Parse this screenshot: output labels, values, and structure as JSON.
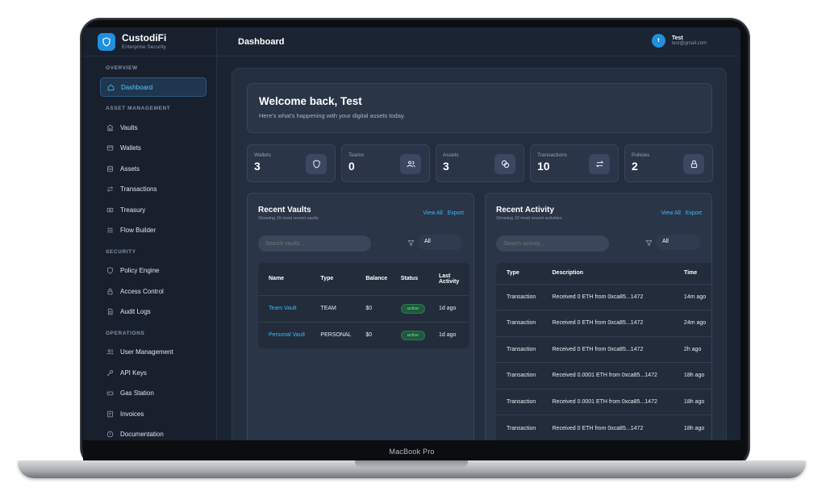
{
  "brand": {
    "name": "CustodiFi",
    "subtitle": "Enterprise Security"
  },
  "header": {
    "title": "Dashboard",
    "user_initial": "t",
    "user_name": "Test",
    "user_email": "test@gmail.com"
  },
  "sidebar": {
    "sections": [
      {
        "title": "OVERVIEW",
        "items": [
          {
            "label": "Dashboard",
            "icon": "home-icon",
            "active": true
          }
        ]
      },
      {
        "title": "ASSET MANAGEMENT",
        "items": [
          {
            "label": "Vaults",
            "icon": "vault-icon"
          },
          {
            "label": "Wallets",
            "icon": "wallet-icon"
          },
          {
            "label": "Assets",
            "icon": "database-icon"
          },
          {
            "label": "Transactions",
            "icon": "arrows-icon"
          },
          {
            "label": "Treasury",
            "icon": "treasury-icon"
          },
          {
            "label": "Flow Builder",
            "icon": "grid-icon"
          }
        ]
      },
      {
        "title": "SECURITY",
        "items": [
          {
            "label": "Policy Engine",
            "icon": "shield-icon"
          },
          {
            "label": "Access Control",
            "icon": "lock-icon"
          },
          {
            "label": "Audit Logs",
            "icon": "file-icon"
          }
        ]
      },
      {
        "title": "OPERATIONS",
        "items": [
          {
            "label": "User Management",
            "icon": "users-icon"
          },
          {
            "label": "API Keys",
            "icon": "key-icon"
          },
          {
            "label": "Gas Station",
            "icon": "fuel-icon"
          },
          {
            "label": "Invoices",
            "icon": "invoice-icon"
          },
          {
            "label": "Documentation",
            "icon": "book-icon"
          }
        ]
      }
    ]
  },
  "welcome": {
    "title": "Welcome back, Test",
    "subtitle": "Here's what's happening with your digital assets today."
  },
  "stats": [
    {
      "label": "Wallets",
      "value": "3",
      "icon": "shield-icon"
    },
    {
      "label": "Teams",
      "value": "0",
      "icon": "users-icon"
    },
    {
      "label": "Assets",
      "value": "3",
      "icon": "coins-icon"
    },
    {
      "label": "Transactions",
      "value": "10",
      "icon": "arrows-icon"
    },
    {
      "label": "Policies",
      "value": "2",
      "icon": "lock-icon"
    }
  ],
  "vaults": {
    "title": "Recent Vaults",
    "subtitle": "Showing 10 most recent vaults",
    "view_all": "View All",
    "export": "Export",
    "search_placeholder": "Search vaults...",
    "filter": "All",
    "columns": [
      "Name",
      "Type",
      "Balance",
      "Status",
      "Last Activity"
    ],
    "rows": [
      {
        "name": "Team Vault",
        "type": "TEAM",
        "balance": "$0",
        "status": "active",
        "last": "1d ago"
      },
      {
        "name": "Personal Vault",
        "type": "PERSONAL",
        "balance": "$0",
        "status": "active",
        "last": "1d ago"
      }
    ]
  },
  "activity": {
    "title": "Recent Activity",
    "subtitle": "Showing 10 most recent activities",
    "view_all": "View All",
    "export": "Export",
    "search_placeholder": "Search activity...",
    "filter": "All",
    "columns": [
      "Type",
      "Description",
      "Time"
    ],
    "rows": [
      {
        "type": "Transaction",
        "description": "Received 0 ETH from 0xca85...1472",
        "time": "14m ago"
      },
      {
        "type": "Transaction",
        "description": "Received 0 ETH from 0xca85...1472",
        "time": "24m ago"
      },
      {
        "type": "Transaction",
        "description": "Received 0 ETH from 0xca85...1472",
        "time": "2h ago"
      },
      {
        "type": "Transaction",
        "description": "Received 0.0001 ETH from 0xca85...1472",
        "time": "18h ago"
      },
      {
        "type": "Transaction",
        "description": "Received 0.0001 ETH from 0xca85...1472",
        "time": "18h ago"
      },
      {
        "type": "Transaction",
        "description": "Received 0 ETH from 0xca85...1472",
        "time": "18h ago"
      }
    ]
  },
  "device_label": "MacBook Pro",
  "colors": {
    "accent": "#41b6f3",
    "brand": "#1f8fe0",
    "background": "#1b2433",
    "success": "#6fe0a0"
  }
}
